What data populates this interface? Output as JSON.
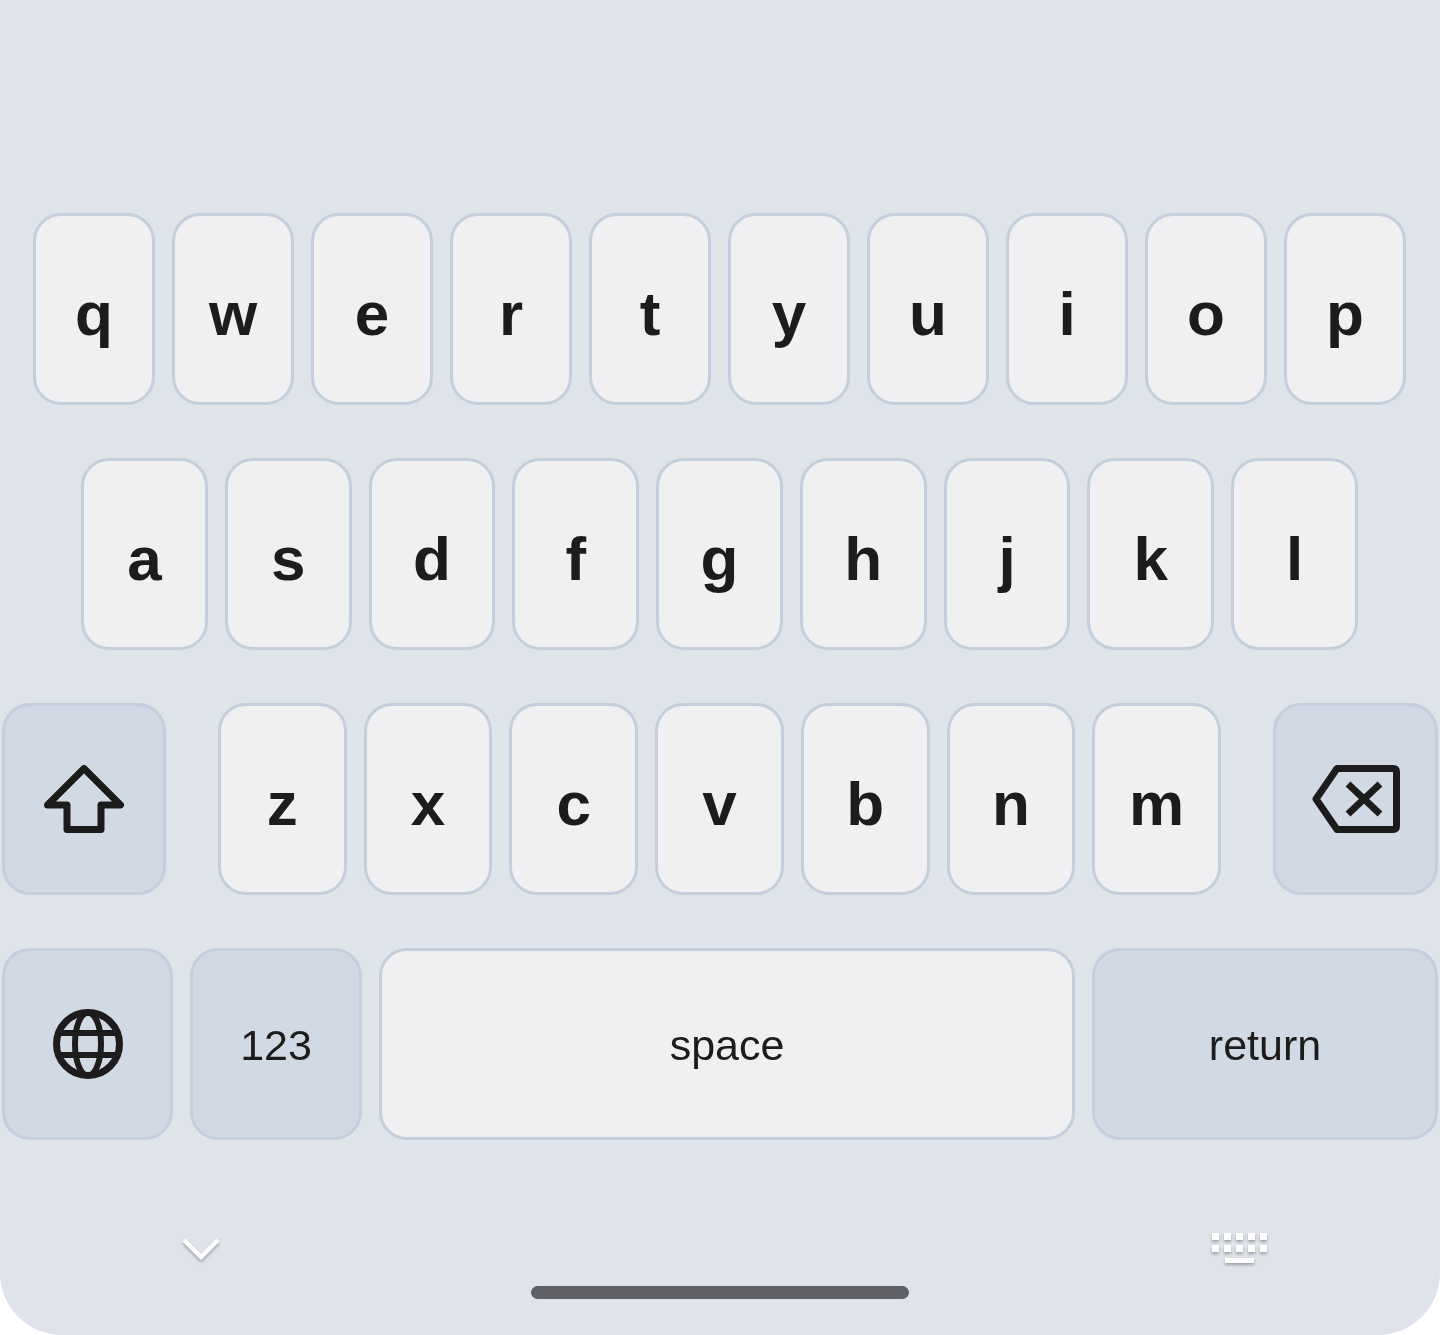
{
  "keyboard": {
    "rows": [
      {
        "keys": [
          {
            "kind": "letter",
            "label": "q"
          },
          {
            "kind": "letter",
            "label": "w"
          },
          {
            "kind": "letter",
            "label": "e"
          },
          {
            "kind": "letter",
            "label": "r"
          },
          {
            "kind": "letter",
            "label": "t"
          },
          {
            "kind": "letter",
            "label": "y"
          },
          {
            "kind": "letter",
            "label": "u"
          },
          {
            "kind": "letter",
            "label": "i"
          },
          {
            "kind": "letter",
            "label": "o"
          },
          {
            "kind": "letter",
            "label": "p"
          }
        ]
      },
      {
        "keys": [
          {
            "kind": "letter",
            "label": "a"
          },
          {
            "kind": "letter",
            "label": "s"
          },
          {
            "kind": "letter",
            "label": "d"
          },
          {
            "kind": "letter",
            "label": "f"
          },
          {
            "kind": "letter",
            "label": "g"
          },
          {
            "kind": "letter",
            "label": "h"
          },
          {
            "kind": "letter",
            "label": "j"
          },
          {
            "kind": "letter",
            "label": "k"
          },
          {
            "kind": "letter",
            "label": "l"
          }
        ]
      },
      {
        "keys": [
          {
            "kind": "shift"
          },
          {
            "kind": "letter",
            "label": "z"
          },
          {
            "kind": "letter",
            "label": "x"
          },
          {
            "kind": "letter",
            "label": "c"
          },
          {
            "kind": "letter",
            "label": "v"
          },
          {
            "kind": "letter",
            "label": "b"
          },
          {
            "kind": "letter",
            "label": "n"
          },
          {
            "kind": "letter",
            "label": "m"
          },
          {
            "kind": "backspace"
          }
        ]
      },
      {
        "keys": [
          {
            "kind": "globe"
          },
          {
            "kind": "mode",
            "label": "123"
          },
          {
            "kind": "space",
            "label": "space"
          },
          {
            "kind": "return",
            "label": "return"
          }
        ]
      }
    ]
  }
}
